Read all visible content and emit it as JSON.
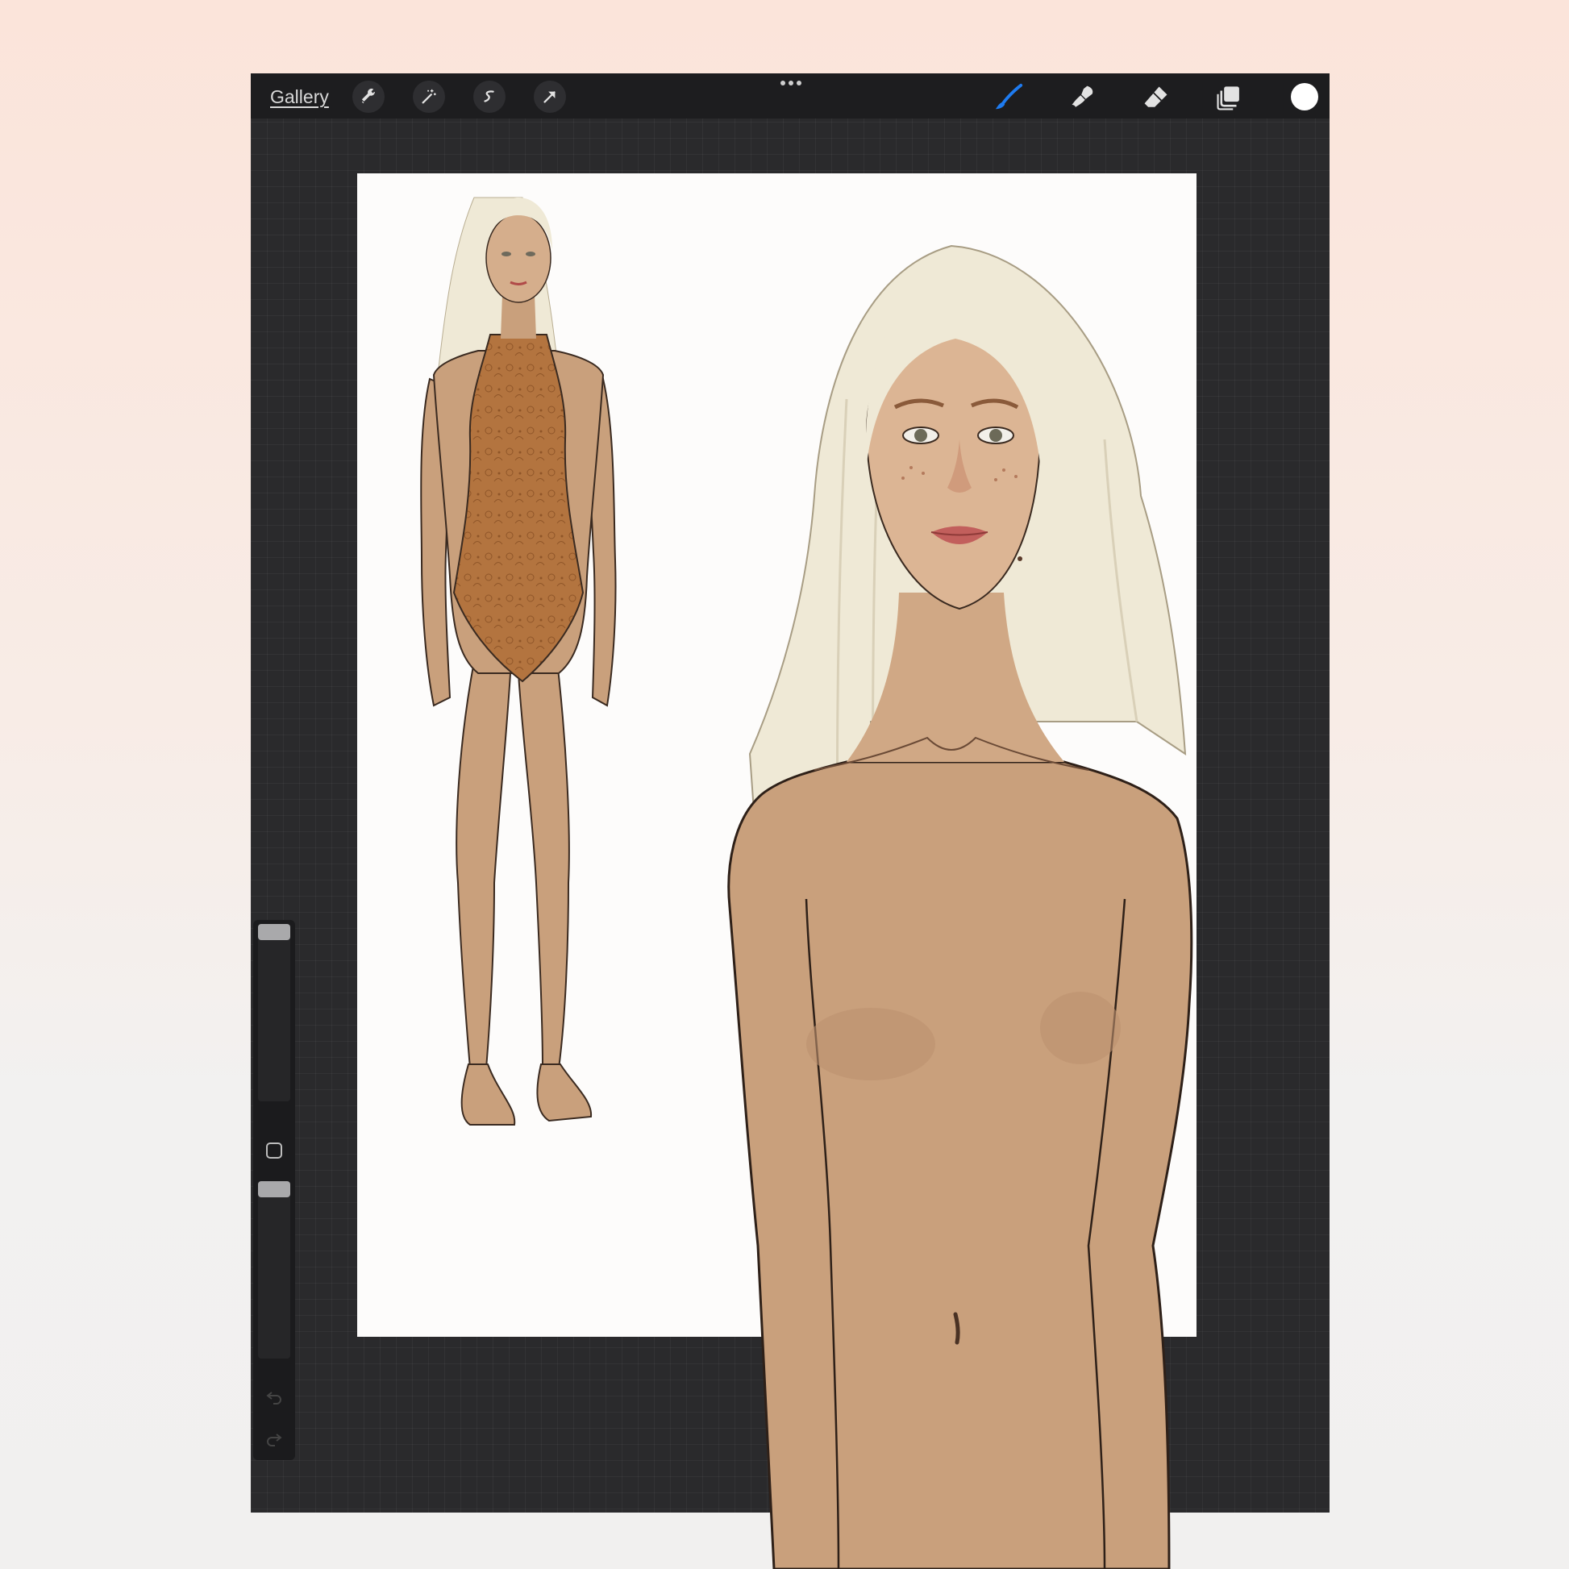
{
  "toolbar": {
    "gallery_label": "Gallery",
    "left_tools": [
      "wrench-icon",
      "magic-wand-icon",
      "selection-icon",
      "transform-arrow-icon"
    ],
    "right_tools": [
      "brush-icon",
      "smudge-icon",
      "eraser-icon",
      "layers-icon"
    ],
    "active_tool": "brush-icon",
    "active_tool_color": "#1e7bf0",
    "current_color": "#ffffff"
  },
  "sidebar": {
    "brush_size_level": 1.0,
    "opacity_level": 1.0,
    "icons": [
      "modify-square-icon",
      "undo-icon",
      "redo-icon"
    ]
  },
  "colors": {
    "skin": "#c9a07c",
    "hair": "#efe9d6",
    "bodysuit": "#b3743f",
    "app_bg": "#2a2a2c",
    "toolbar_bg": "#1d1d1f"
  }
}
